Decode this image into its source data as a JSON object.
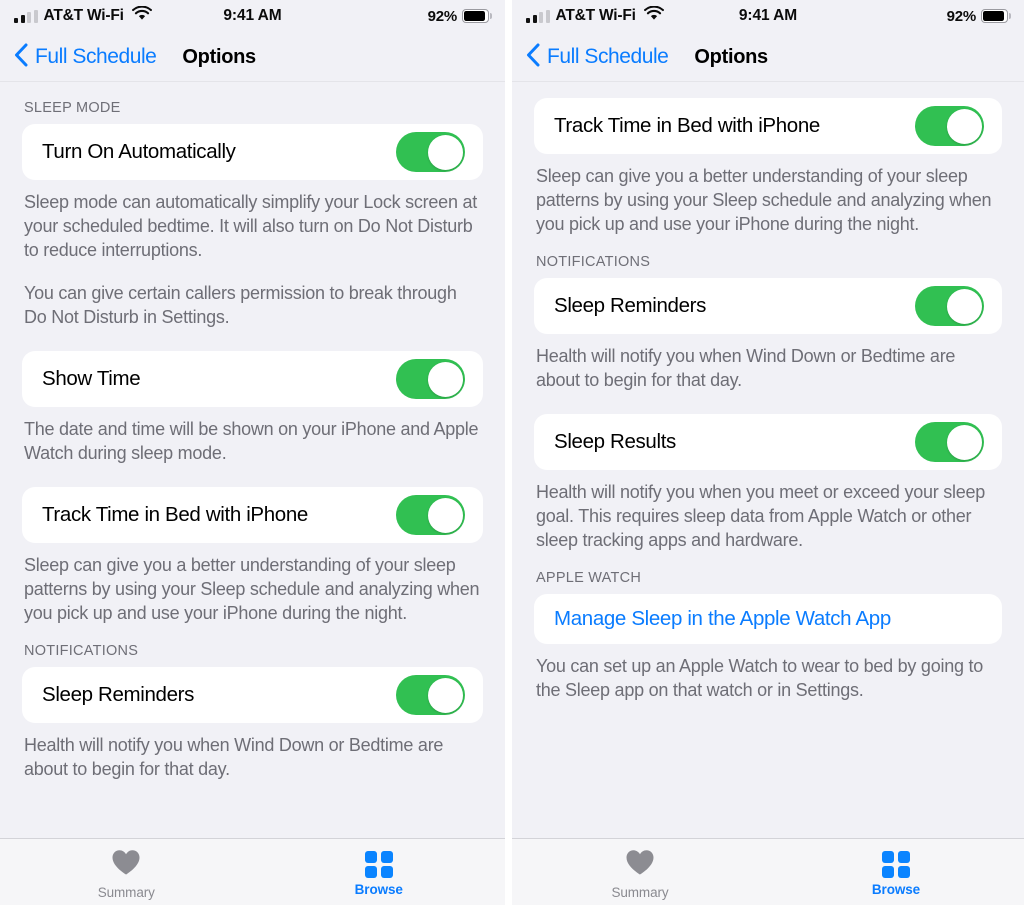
{
  "colors": {
    "accent_blue": "#0a7cff",
    "toggle_green": "#31c052",
    "page_bg": "#f1f1f6",
    "card_bg": "#ffffff",
    "secondary_text": "#6e6e76",
    "tab_inactive": "#8a8a90",
    "tab_active": "#0a84ff"
  },
  "status_bar": {
    "carrier": "AT&T Wi-Fi",
    "time": "9:41 AM",
    "battery_percent": "92%",
    "signal_icon": "cellular-signal-icon",
    "wifi_icon": "wifi-icon",
    "battery_icon": "battery-icon"
  },
  "nav": {
    "back_label": "Full Schedule",
    "back_icon": "chevron-left-icon",
    "title": "Options"
  },
  "tabbar": {
    "tabs": [
      {
        "label": "Summary",
        "icon": "heart-icon",
        "active": false
      },
      {
        "label": "Browse",
        "icon": "grid-squares-icon",
        "active": true
      }
    ]
  },
  "left_screen": {
    "sections": [
      {
        "header": "SLEEP MODE",
        "rows": [
          {
            "label": "Turn On Automatically",
            "control": "toggle",
            "value": "on",
            "description": [
              "Sleep mode can automatically simplify your Lock screen at your scheduled bedtime. It will also turn on Do Not Disturb to reduce interruptions.",
              "You can give certain callers permission to break through Do Not Disturb in Settings."
            ]
          },
          {
            "label": "Show Time",
            "control": "toggle",
            "value": "on",
            "description": [
              "The date and time will be shown on your iPhone and Apple Watch during sleep mode."
            ]
          },
          {
            "label": "Track Time in Bed with iPhone",
            "control": "toggle",
            "value": "on",
            "description": [
              "Sleep can give you a better understanding of your sleep patterns by using your Sleep schedule and analyzing when you pick up and use your iPhone during the night."
            ]
          }
        ]
      },
      {
        "header": "NOTIFICATIONS",
        "rows": [
          {
            "label": "Sleep Reminders",
            "control": "toggle",
            "value": "on",
            "description": [
              "Health will notify you when Wind Down or Bedtime are about to begin for that day."
            ]
          }
        ]
      }
    ]
  },
  "right_screen": {
    "sections": [
      {
        "header": "",
        "rows": [
          {
            "label": "Track Time in Bed with iPhone",
            "control": "toggle",
            "value": "on",
            "description": [
              "Sleep can give you a better understanding of your sleep patterns by using your Sleep schedule and analyzing when you pick up and use your iPhone during the night."
            ]
          }
        ]
      },
      {
        "header": "NOTIFICATIONS",
        "rows": [
          {
            "label": "Sleep Reminders",
            "control": "toggle",
            "value": "on",
            "description": [
              "Health will notify you when Wind Down or Bedtime are about to begin for that day."
            ]
          },
          {
            "label": "Sleep Results",
            "control": "toggle",
            "value": "on",
            "description": [
              "Health will notify you when you meet or exceed your sleep goal. This requires sleep data from Apple Watch or other sleep tracking apps and hardware."
            ]
          }
        ]
      },
      {
        "header": "APPLE WATCH",
        "rows": [
          {
            "label": "Manage Sleep in the Apple Watch App",
            "control": "link",
            "description": [
              "You can set up an Apple Watch to wear to bed by going to the Sleep app on that watch or in Settings."
            ]
          }
        ]
      }
    ]
  }
}
